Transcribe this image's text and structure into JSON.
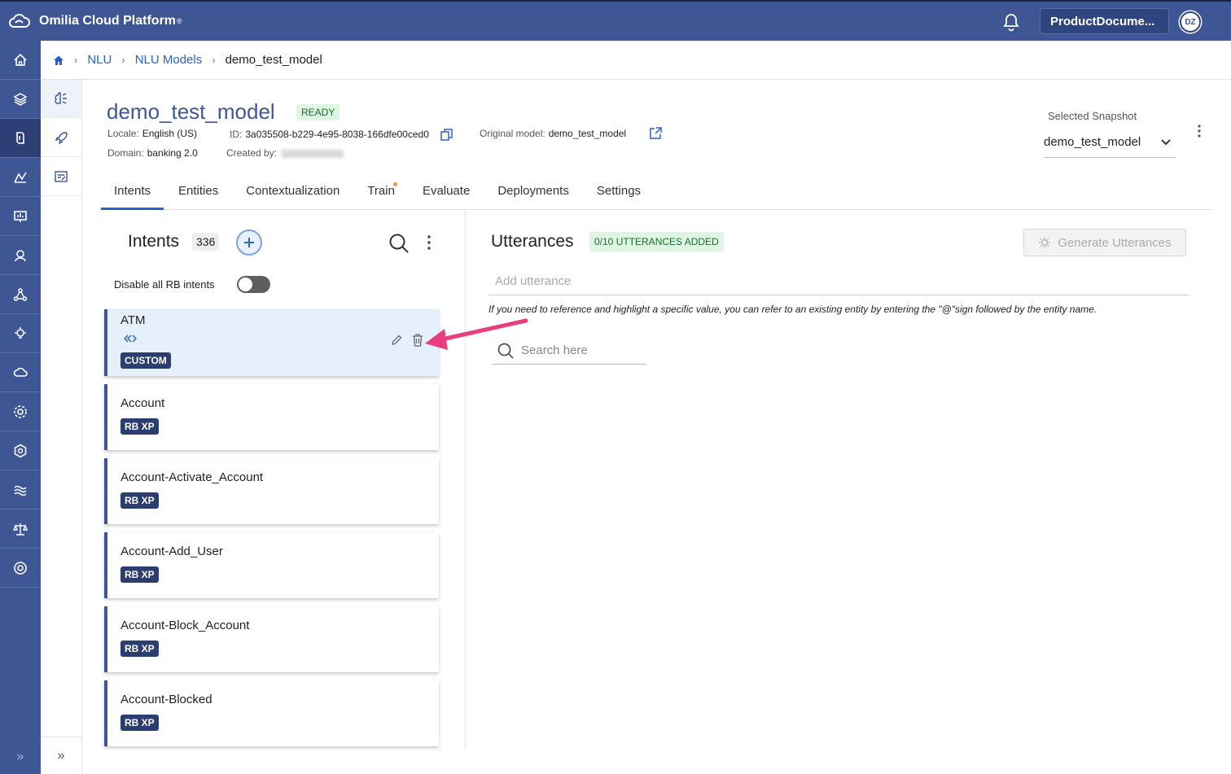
{
  "app": {
    "title": "Omilia Cloud Platform",
    "trademark": "®"
  },
  "header": {
    "org_name": "ProductDocume...",
    "avatar_initials": "DZ"
  },
  "breadcrumb": {
    "items": [
      "NLU",
      "NLU Models"
    ],
    "current": "demo_test_model"
  },
  "model": {
    "name": "demo_test_model",
    "status": "READY",
    "locale_label": "Locale:",
    "locale": "English (US)",
    "id_label": "ID:",
    "id": "3a035508-b229-4e95-8038-166dfe00ced0",
    "original_label": "Original model:",
    "original": "demo_test_model",
    "domain_label": "Domain:",
    "domain": "banking 2.0",
    "created_by_label": "Created by:"
  },
  "snapshot": {
    "label": "Selected Snapshot",
    "value": "demo_test_model"
  },
  "tabs": [
    {
      "label": "Intents"
    },
    {
      "label": "Entities"
    },
    {
      "label": "Contextualization"
    },
    {
      "label": "Train"
    },
    {
      "label": "Evaluate"
    },
    {
      "label": "Deployments"
    },
    {
      "label": "Settings"
    }
  ],
  "intents": {
    "title": "Intents",
    "count": "336",
    "disable_rb_label": "Disable all RB intents",
    "items": [
      {
        "name": "ATM",
        "badge": "CUSTOM"
      },
      {
        "name": "Account",
        "badge": "RB XP"
      },
      {
        "name": "Account-Activate_Account",
        "badge": "RB XP"
      },
      {
        "name": "Account-Add_User",
        "badge": "RB XP"
      },
      {
        "name": "Account-Block_Account",
        "badge": "RB XP"
      },
      {
        "name": "Account-Blocked",
        "badge": "RB XP"
      }
    ]
  },
  "utterances": {
    "title": "Utterances",
    "badge": "0/10 UTTERANCES ADDED",
    "generate_label": "Generate Utterances",
    "add_placeholder": "Add utterance",
    "hint": "If you need to reference and highlight a specific value, you can refer to an existing entity by entering the \"@\"sign followed by the entity name.",
    "search_placeholder": "Search here"
  },
  "colors": {
    "nav": "#3f5694",
    "accent": "#2a62c9",
    "badge": "#2b3e6f",
    "arrow": "#e83e7f"
  }
}
